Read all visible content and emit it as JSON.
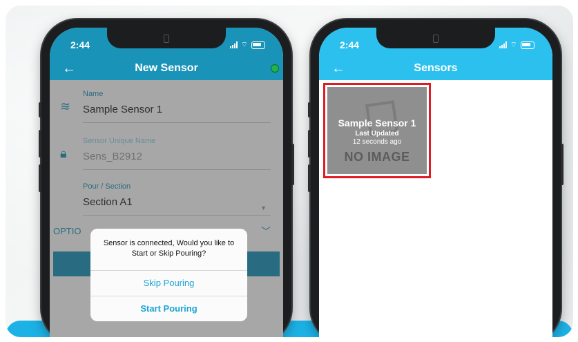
{
  "left_phone": {
    "status": {
      "time": "2:44"
    },
    "nav": {
      "title": "New Sensor",
      "back": "←"
    },
    "fields": [
      {
        "label": "Name",
        "value": "Sample Sensor 1"
      },
      {
        "label": "Sensor Unique Name",
        "value": "Sens_B2912"
      },
      {
        "label": "Pour / Section",
        "value": "Section A1"
      }
    ],
    "options_label": "OPTIO",
    "dialog": {
      "message": "Sensor is connected, Would you like to Start or Skip Pouring?",
      "skip": "Skip Pouring",
      "start": "Start Pouring"
    }
  },
  "right_phone": {
    "status": {
      "time": "2:44"
    },
    "nav": {
      "title": "Sensors",
      "back": "←"
    },
    "tile": {
      "name": "Sample Sensor 1",
      "updated_label": "Last Updated",
      "updated_ago": "12 seconds ago",
      "no_image": "NO IMAGE"
    }
  },
  "colors": {
    "left_header": "#1a93b8",
    "right_header": "#2cc0ef",
    "accent": "#1ba4d4",
    "highlight": "#e01b24",
    "bottom_band": "#1db2e6"
  }
}
